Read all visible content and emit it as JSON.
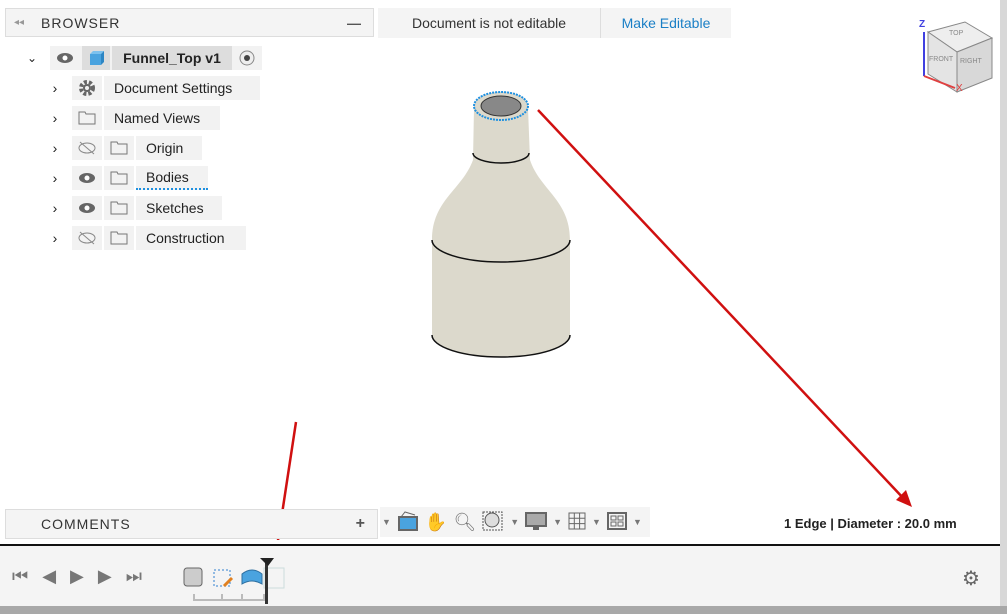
{
  "browser": {
    "title": "BROWSER",
    "root": "Funnel_Top v1",
    "items": [
      {
        "label": "Document Settings",
        "icon": "gear-icon"
      },
      {
        "label": "Named Views",
        "icon": "folder-icon"
      },
      {
        "label": "Origin",
        "icon": "folder-icon",
        "visible": false
      },
      {
        "label": "Bodies",
        "icon": "folder-icon",
        "visible": true
      },
      {
        "label": "Sketches",
        "icon": "folder-icon",
        "visible": true
      },
      {
        "label": "Construction",
        "icon": "folder-icon",
        "visible": false
      }
    ]
  },
  "banner": {
    "status": "Document is not editable",
    "action": "Make Editable"
  },
  "comments": {
    "title": "COMMENTS",
    "add": "+"
  },
  "viewcube": {
    "top": "TOP",
    "front": "FRONT",
    "right": "RIGHT",
    "z": "Z",
    "x": "X"
  },
  "status_text": "1 Edge | Diameter : 20.0 mm",
  "colors": {
    "accent": "#1a7fc6",
    "arrow": "#d01010",
    "selection": "#1e90e0"
  }
}
